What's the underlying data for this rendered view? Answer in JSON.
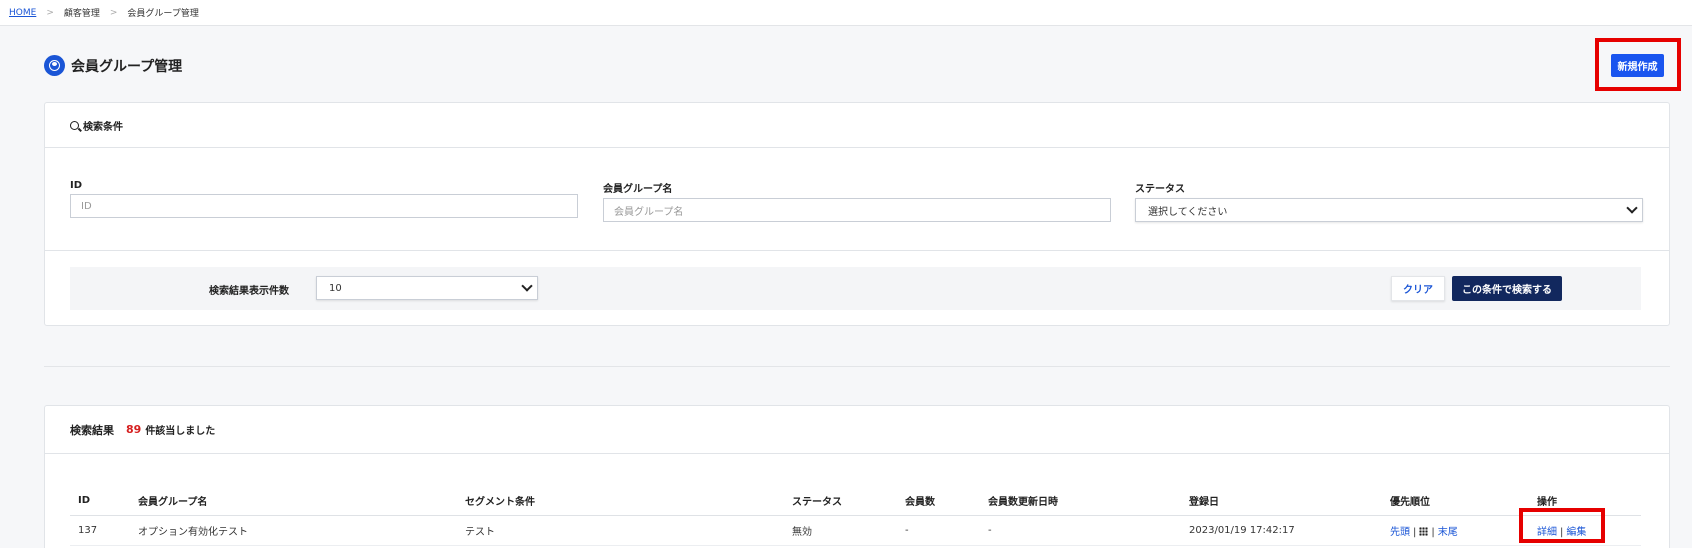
{
  "breadcrumb": {
    "home": "HOME",
    "level1": "顧客管理",
    "level2": "会員グループ管理"
  },
  "page": {
    "title": "会員グループ管理",
    "new_button": "新規作成"
  },
  "search": {
    "title": "検索条件",
    "id": {
      "label": "ID",
      "placeholder": "ID"
    },
    "group_name": {
      "label": "会員グループ名",
      "placeholder": "会員グループ名"
    },
    "status": {
      "label": "ステータス",
      "selected": "選択してください"
    },
    "per_page": {
      "label": "検索結果表示件数",
      "selected": "10"
    },
    "clear_button": "クリア",
    "search_button": "この条件で検索する"
  },
  "results": {
    "title": "検索結果",
    "count": "89",
    "count_suffix": "件該当しました",
    "columns": [
      "ID",
      "会員グループ名",
      "セグメント条件",
      "ステータス",
      "会員数",
      "会員数更新日時",
      "登録日",
      "優先順位",
      "操作"
    ],
    "rows": [
      {
        "id": "137",
        "name": "オプション有効化テスト",
        "segment": "テスト",
        "status": "無効",
        "members": "-",
        "members_updated": "-",
        "registered": "2023/01/19 17:42:17",
        "priority_first": "先頭",
        "priority_last": "末尾",
        "action_detail": "詳細",
        "action_edit": "編集"
      }
    ]
  },
  "colors": {
    "accent": "#1a55ef",
    "navy": "#12285e",
    "highlight": "#e60000",
    "count": "#d61f1f"
  },
  "icons": [
    "user-circle-icon",
    "search-icon",
    "chevron-down-icon",
    "drag-grid-icon"
  ]
}
